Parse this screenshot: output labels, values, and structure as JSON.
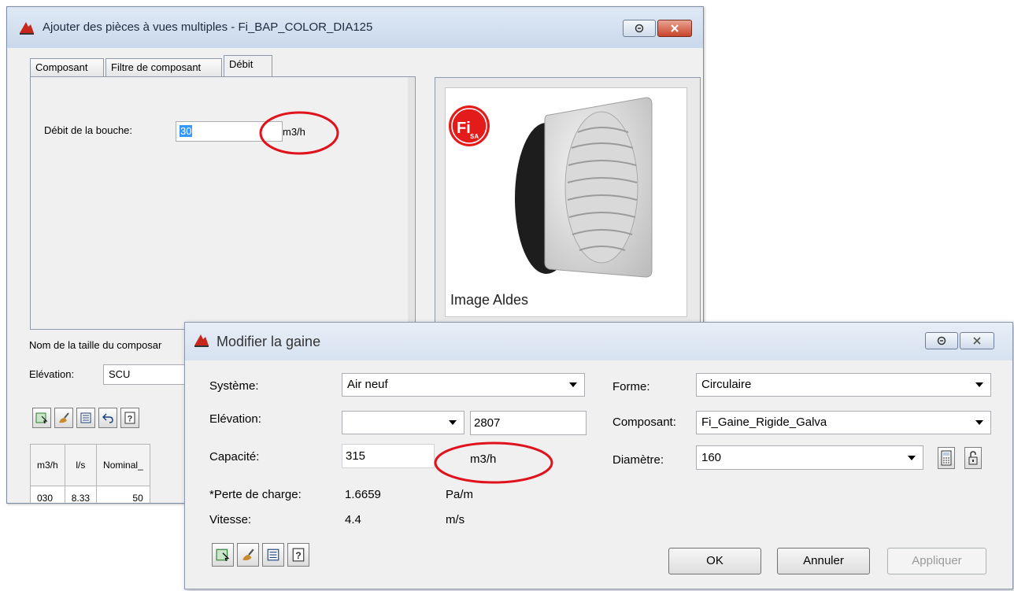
{
  "back_dialog": {
    "title": "Ajouter des pièces à vues multiples - Fi_BAP_COLOR_DIA125",
    "tabs": [
      {
        "label": "Composant"
      },
      {
        "label": "Filtre de composant"
      },
      {
        "label": "Débit"
      }
    ],
    "flow_label": "Débit de la bouche:",
    "flow_value": "30",
    "flow_unit": "m3/h",
    "image_caption": "Image Aldes",
    "logo_text": "Fi",
    "logo_sub": "SA",
    "size_name_label": "Nom de la taille du composar",
    "elevation_label": "Elévation:",
    "elevation_value": "SCU",
    "table": {
      "headers": [
        "m3/h",
        "l/s",
        "Nominal_"
      ],
      "rows": [
        [
          "030",
          "8.33",
          "50"
        ]
      ]
    }
  },
  "front_dialog": {
    "title": "Modifier la gaine",
    "systeme_label": "Système:",
    "systeme_value": "Air neuf",
    "elevation_label": "Elévation:",
    "elevation_combo_value": "",
    "elevation_value": "2807",
    "capacite_label": "Capacité:",
    "capacite_value": "315",
    "capacite_unit": "m3/h",
    "perte_label": "*Perte de charge:",
    "perte_value": "1.6659",
    "perte_unit": "Pa/m",
    "vitesse_label": "Vitesse:",
    "vitesse_value": "4.4",
    "vitesse_unit": "m/s",
    "forme_label": "Forme:",
    "forme_value": "Circulaire",
    "composant_label": "Composant:",
    "composant_value": "Fi_Gaine_Rigide_Galva",
    "diametre_label": "Diamètre:",
    "diametre_value": "160",
    "ok_label": "OK",
    "annuler_label": "Annuler",
    "appliquer_label": "Appliquer"
  },
  "colors": {
    "annotation": "#e0121b",
    "selection": "#3399ff",
    "titlebar": "#d6e2f0"
  }
}
